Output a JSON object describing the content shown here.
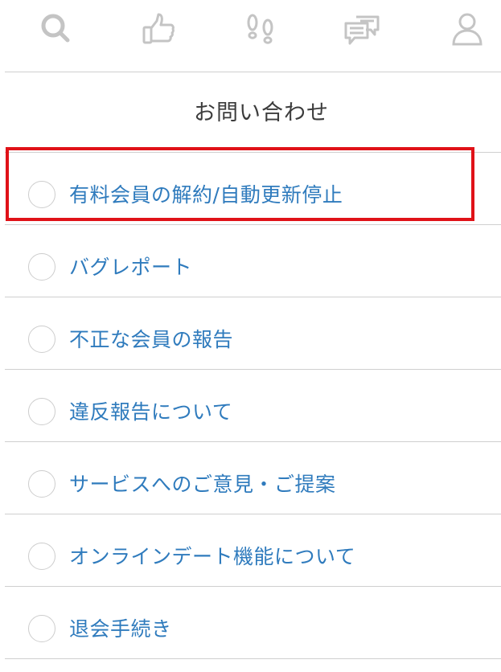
{
  "nav": {
    "items": [
      {
        "icon": "search-icon"
      },
      {
        "icon": "thumbs-up-icon"
      },
      {
        "icon": "footprints-icon"
      },
      {
        "icon": "chat-bubbles-icon"
      },
      {
        "icon": "user-icon"
      }
    ],
    "icon_color": "#c4c4c4"
  },
  "page": {
    "title": "お問い合わせ"
  },
  "options": [
    {
      "label": "有料会員の解約/自動更新停止",
      "highlighted": true
    },
    {
      "label": "バグレポート"
    },
    {
      "label": "不正な会員の報告"
    },
    {
      "label": "違反報告について"
    },
    {
      "label": "サービスへのご意見・ご提案"
    },
    {
      "label": "オンラインデート機能について"
    },
    {
      "label": "退会手続き"
    }
  ],
  "colors": {
    "link_text": "#2f7bbd",
    "highlight_border": "#e01218",
    "divider": "#cfcfcf"
  }
}
